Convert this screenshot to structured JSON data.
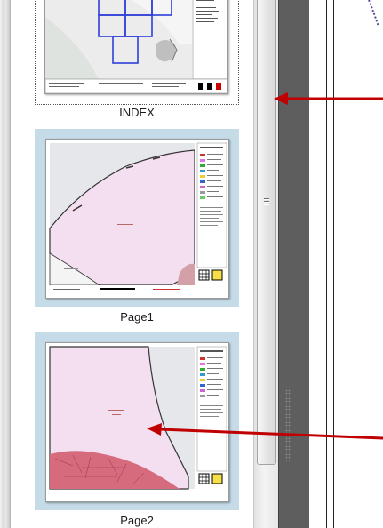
{
  "thumbnails": [
    {
      "label": "INDEX"
    },
    {
      "label": "Page1"
    },
    {
      "label": "Page2"
    }
  ],
  "colors": {
    "selection_frame": "#c5dbe8",
    "arrow": "#c00000",
    "map_pink": "#f3dff0",
    "map_grey": "#e6e7ea",
    "grid_blue": "#2e3fd8"
  }
}
